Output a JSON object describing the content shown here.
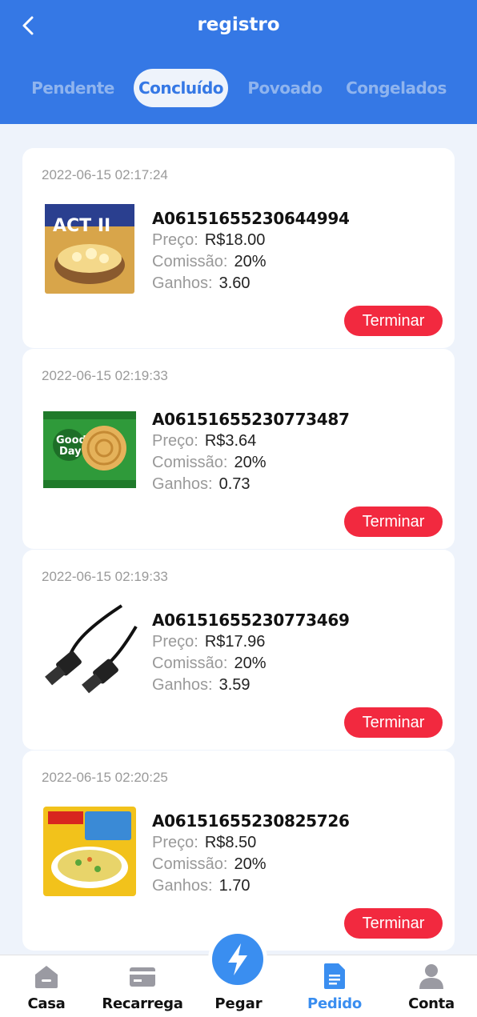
{
  "header": {
    "title": "registro",
    "tabs": [
      {
        "label": "Pendente"
      },
      {
        "label": "Concluído"
      },
      {
        "label": "Povoado"
      },
      {
        "label": "Congelados"
      }
    ],
    "active_tab": "Concluído"
  },
  "labels": {
    "price": "Preço:",
    "commission": "Comissão:",
    "earnings": "Ganhos:"
  },
  "orders": [
    {
      "date": "2022-06-15 02:17:24",
      "id": "A06151655230644994",
      "price": "R$18.00",
      "commission": "20%",
      "earnings": "3.60",
      "action": "Terminar",
      "product_icon": "popcorn-pack-icon"
    },
    {
      "date": "2022-06-15 02:19:33",
      "id": "A06151655230773487",
      "price": "R$3.64",
      "commission": "20%",
      "earnings": "0.73",
      "action": "Terminar",
      "product_icon": "biscuit-pack-icon"
    },
    {
      "date": "2022-06-15 02:19:33",
      "id": "A06151655230773469",
      "price": "R$17.96",
      "commission": "20%",
      "earnings": "3.59",
      "action": "Terminar",
      "product_icon": "hdmi-cable-icon"
    },
    {
      "date": "2022-06-15 02:20:25",
      "id": "A06151655230825726",
      "price": "R$8.50",
      "commission": "20%",
      "earnings": "1.70",
      "action": "Terminar",
      "product_icon": "noodle-pack-icon"
    }
  ],
  "nav": {
    "casa": "Casa",
    "recarrega": "Recarrega",
    "pegar": "Pegar",
    "pedido": "Pedido",
    "conta": "Conta",
    "active": "Pedido"
  },
  "colors": {
    "header": "#3578e5",
    "accent": "#3a8ef0",
    "action": "#f2293f",
    "background": "#eef3fb"
  }
}
